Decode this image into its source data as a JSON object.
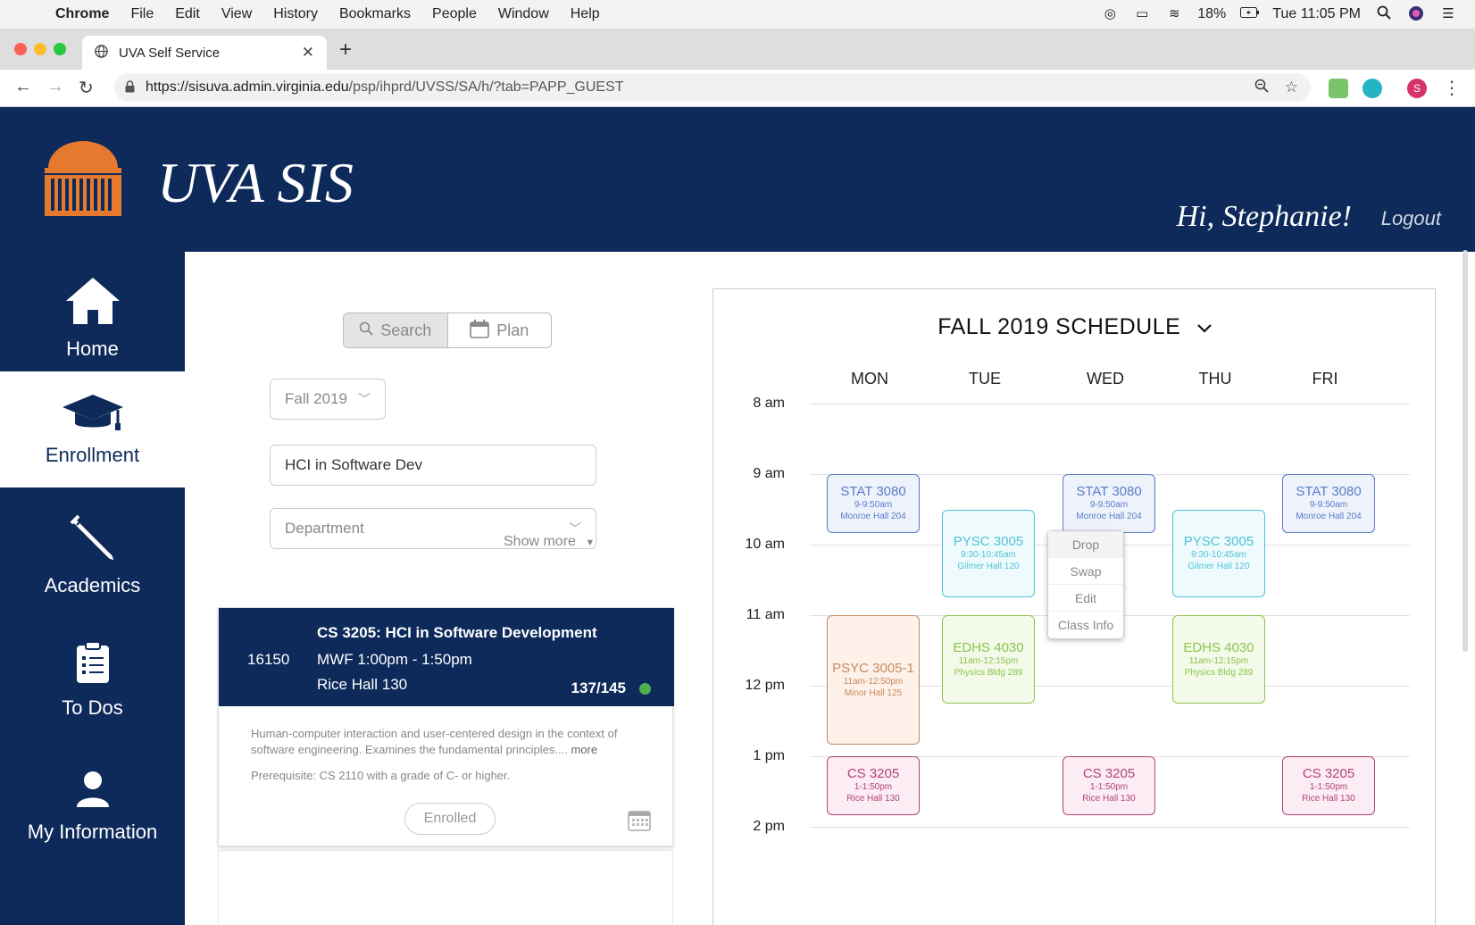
{
  "menubar": {
    "items": [
      "Chrome",
      "File",
      "Edit",
      "View",
      "History",
      "Bookmarks",
      "People",
      "Window",
      "Help"
    ],
    "battery": "18%",
    "clock": "Tue 11:05 PM"
  },
  "browser": {
    "tab_title": "UVA Self Service",
    "url_host": "https://sisuva.admin.virginia.edu",
    "url_path": "/psp/ihprd/UVSS/SA/h/?tab=PAPP_GUEST",
    "profile_initial": "S"
  },
  "header": {
    "title": "UVA SIS",
    "greeting": "Hi, Stephanie!",
    "logout": "Logout"
  },
  "sidebar": {
    "items": [
      {
        "label": "Home",
        "icon": "home-icon"
      },
      {
        "label": "Enrollment",
        "icon": "graduation-cap-icon"
      },
      {
        "label": "Academics",
        "icon": "pencil-icon"
      },
      {
        "label": "To Dos",
        "icon": "clipboard-icon"
      },
      {
        "label": "My Information",
        "icon": "user-icon"
      }
    ],
    "active": "Enrollment"
  },
  "search_panel": {
    "toggle_search": "Search",
    "toggle_plan": "Plan",
    "term": "Fall 2019",
    "query": "HCI in Software Dev",
    "department_placeholder": "Department",
    "show_more": "Show more"
  },
  "course_card": {
    "number": "16150",
    "title": "CS 3205: HCI in Software Development",
    "time": "MWF 1:00pm - 1:50pm",
    "room": "Rice Hall 130",
    "seats": "137/145",
    "description": "Human-computer interaction and user-centered design in the context of software engineering. Examines the fundamental principles....",
    "more": "more",
    "prereq": "Prerequisite: CS 2110 with a grade of C- or higher.",
    "status": "Enrolled"
  },
  "schedule": {
    "title": "FALL 2019 SCHEDULE",
    "days": [
      "MON",
      "TUE",
      "WED",
      "THU",
      "FRI"
    ],
    "hours": [
      "8 am",
      "9 am",
      "10 am",
      "11 am",
      "12 pm",
      "1 pm",
      "2 pm"
    ],
    "events": [
      {
        "day": "MON",
        "name": "STAT 3080",
        "time": "9-9:50am",
        "room": "Monroe Hall 204",
        "color": "#5b7bc9",
        "bg": "#eef2fb"
      },
      {
        "day": "WED",
        "name": "STAT 3080",
        "time": "9-9:50am",
        "room": "Monroe Hall 204",
        "color": "#5b7bc9",
        "bg": "#eef2fb"
      },
      {
        "day": "FRI",
        "name": "STAT 3080",
        "time": "9-9:50am",
        "room": "Monroe Hall 204",
        "color": "#5b7bc9",
        "bg": "#eef2fb"
      },
      {
        "day": "TUE",
        "name": "PYSC 3005",
        "time": "9:30-10:45am",
        "room": "Gilmer Hall 120",
        "color": "#4fc3d9",
        "bg": "#eefafc"
      },
      {
        "day": "THU",
        "name": "PYSC 3005",
        "time": "9:30-10:45am",
        "room": "Gilmer Hall 120",
        "color": "#4fc3d9",
        "bg": "#eefafc"
      },
      {
        "day": "MON",
        "name": "PSYC 3005-1",
        "time": "11am-12:50pm",
        "room": "Minor Hall 125",
        "color": "#c98a5e",
        "bg": "#fdf1e9"
      },
      {
        "day": "TUE",
        "name": "EDHS 4030",
        "time": "11am-12:15pm",
        "room": "Physics Bldg 289",
        "color": "#8dc44e",
        "bg": "#f3fae9"
      },
      {
        "day": "THU",
        "name": "EDHS 4030",
        "time": "11am-12:15pm",
        "room": "Physics Bldg 289",
        "color": "#8dc44e",
        "bg": "#f3fae9"
      },
      {
        "day": "MON",
        "name": "CS 3205",
        "time": "1-1:50pm",
        "room": "Rice Hall 130",
        "color": "#b0457a",
        "bg": "#fcecf3"
      },
      {
        "day": "WED",
        "name": "CS 3205",
        "time": "1-1:50pm",
        "room": "Rice Hall 130",
        "color": "#b0457a",
        "bg": "#fcecf3"
      },
      {
        "day": "FRI",
        "name": "CS 3205",
        "time": "1-1:50pm",
        "room": "Rice Hall 130",
        "color": "#b0457a",
        "bg": "#fcecf3"
      }
    ],
    "context_menu": [
      "Drop",
      "Swap",
      "Edit",
      "Class Info"
    ]
  }
}
